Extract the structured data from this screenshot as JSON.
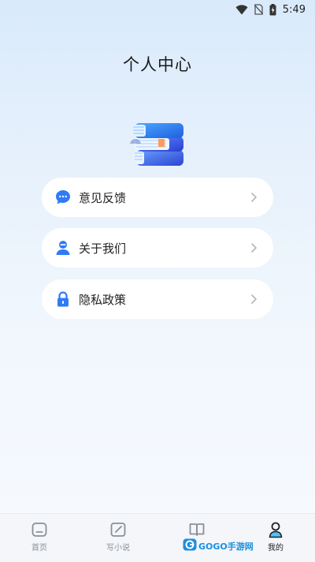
{
  "status_bar": {
    "time": "5:49",
    "icons": [
      "wifi-icon",
      "no-sim-icon",
      "battery-charging-icon"
    ]
  },
  "header": {
    "title": "个人中心"
  },
  "app_logo": {
    "icon": "stacked-books-logo"
  },
  "menu": {
    "items": [
      {
        "label": "意见反馈",
        "icon": "feedback-chat-icon",
        "color": "#2f7bf5"
      },
      {
        "label": "关于我们",
        "icon": "user-info-icon",
        "color": "#2f7bf5"
      },
      {
        "label": "隐私政策",
        "icon": "lock-icon",
        "color": "#2f7bf5"
      }
    ]
  },
  "tabbar": {
    "tabs": [
      {
        "label": "首页",
        "icon": "home-icon",
        "active": false
      },
      {
        "label": "写小说",
        "icon": "edit-icon",
        "active": false
      },
      {
        "label": "",
        "icon": "book-open-icon",
        "active": false
      },
      {
        "label": "我的",
        "icon": "profile-icon",
        "active": true
      }
    ]
  },
  "watermark": {
    "text": "GOGO手游网"
  },
  "colors": {
    "accent": "#2f7bf5",
    "background_top": "#d9eafb",
    "card": "#ffffff",
    "tab_inactive": "#8a8f98"
  }
}
